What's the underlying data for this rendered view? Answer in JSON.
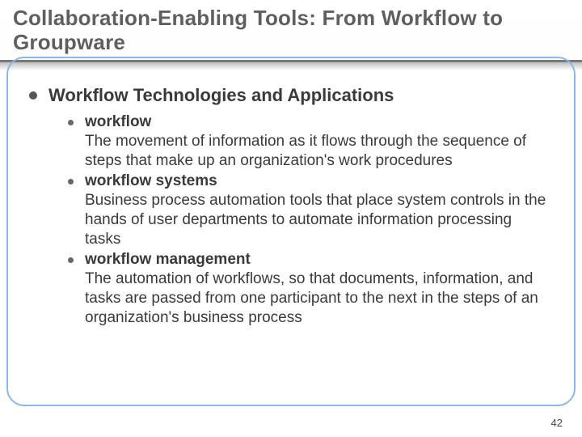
{
  "title": "Collaboration-Enabling Tools: From Workflow to Groupware",
  "heading": "Workflow Technologies and Applications",
  "items": [
    {
      "term": "workflow",
      "definition": "The movement of information as it flows through the sequence of steps that make up an organization's work procedures"
    },
    {
      "term": "workflow systems",
      "definition": "Business process automation tools that place system controls in the hands of user departments to automate information processing tasks"
    },
    {
      "term": "workflow management",
      "definition": "The automation of workflows, so that documents, information, and tasks are passed from one participant to the next in the steps of an organization's business process"
    }
  ],
  "pageNumber": "42"
}
